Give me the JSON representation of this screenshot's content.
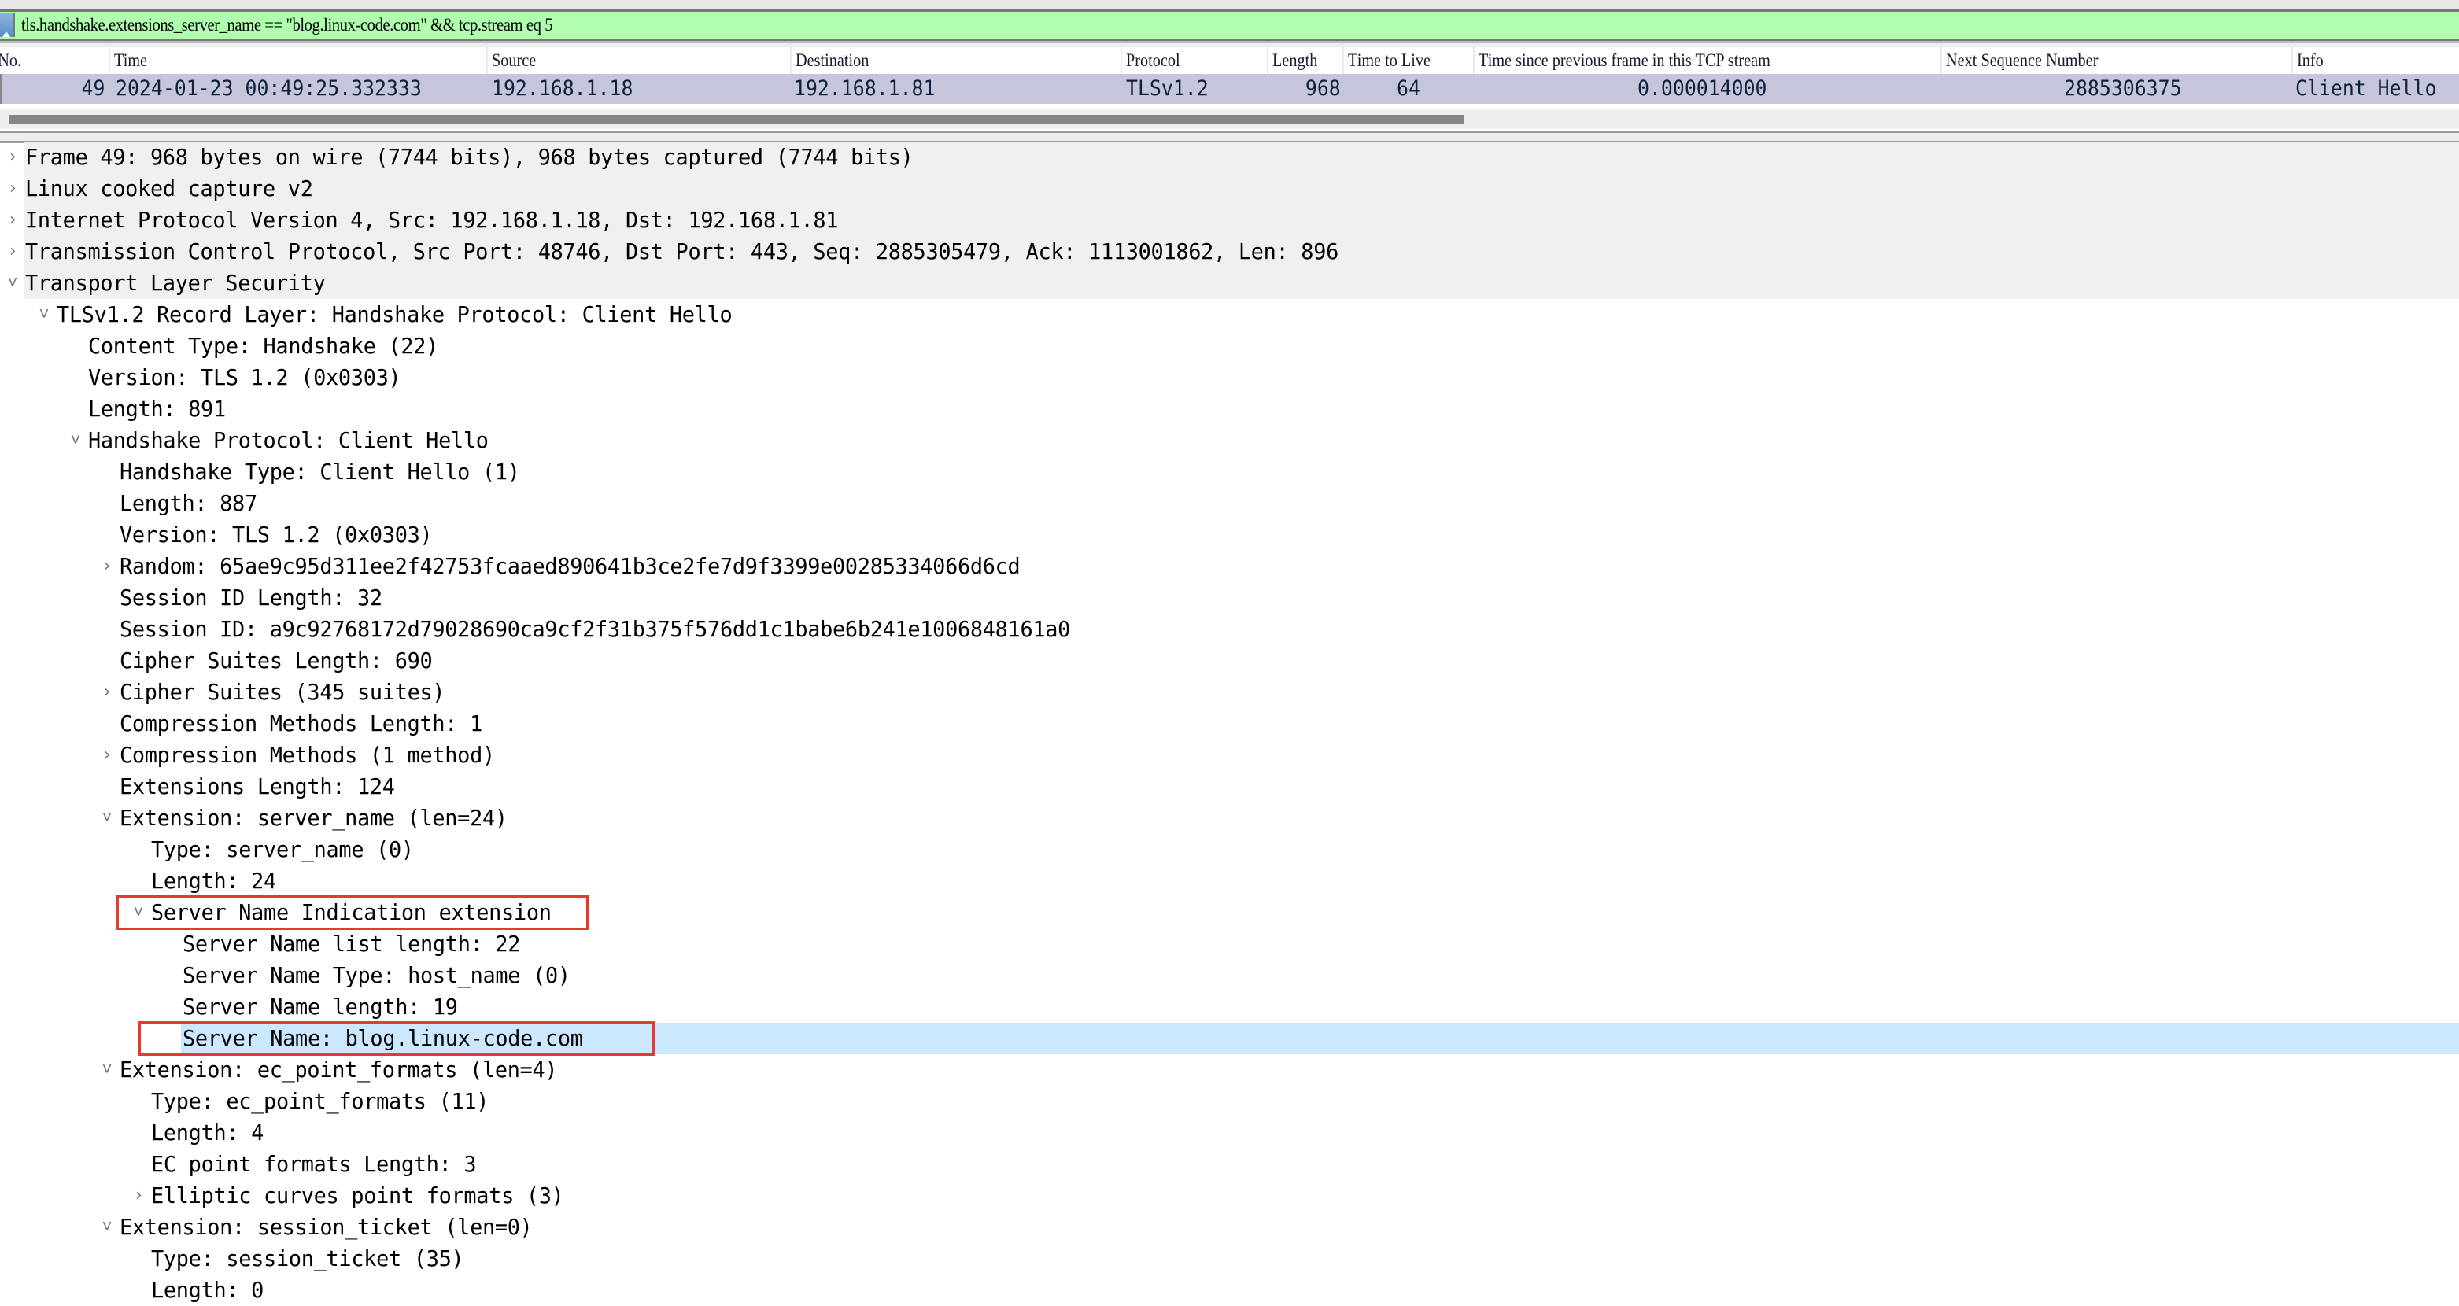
{
  "filter": {
    "expression": "tls.handshake.extensions_server_name == \"blog.linux-code.com\" && tcp.stream eq 5",
    "background": "#afffaf",
    "icon": "bookmark-filter-icon"
  },
  "packet_list": {
    "columns": [
      "No.",
      "Time",
      "Source",
      "Destination",
      "Protocol",
      "Length",
      "Time to Live",
      "Time since previous frame in this TCP stream",
      "Next Sequence Number",
      "Info"
    ],
    "rows": [
      {
        "no": "49",
        "time": "2024-01-23 00:49:25.332333",
        "source": "192.168.1.18",
        "destination": "192.168.1.81",
        "protocol": "TLSv1.2",
        "length": "968",
        "ttl": "64",
        "time_since_prev": "0.000014000",
        "next_seq": "2885306375",
        "info": "Client Hello",
        "selected": true
      }
    ],
    "selected_row_color": "#c5c5db"
  },
  "details": {
    "selected_color": "#cce8ff",
    "highlight_color": "#e53935",
    "rows": [
      {
        "depth": 0,
        "state": "collapsed",
        "text": "Frame 49: 968 bytes on wire (7744 bits), 968 bytes captured (7744 bits)"
      },
      {
        "depth": 0,
        "state": "collapsed",
        "text": "Linux cooked capture v2"
      },
      {
        "depth": 0,
        "state": "collapsed",
        "text": "Internet Protocol Version 4, Src: 192.168.1.18, Dst: 192.168.1.81"
      },
      {
        "depth": 0,
        "state": "collapsed",
        "text": "Transmission Control Protocol, Src Port: 48746, Dst Port: 443, Seq: 2885305479, Ack: 1113001862, Len: 896"
      },
      {
        "depth": 0,
        "state": "expanded",
        "text": "Transport Layer Security"
      },
      {
        "depth": 1,
        "state": "expanded",
        "text": "TLSv1.2 Record Layer: Handshake Protocol: Client Hello"
      },
      {
        "depth": 2,
        "state": "leaf",
        "text": "Content Type: Handshake (22)"
      },
      {
        "depth": 2,
        "state": "leaf",
        "text": "Version: TLS 1.2 (0x0303)"
      },
      {
        "depth": 2,
        "state": "leaf",
        "text": "Length: 891"
      },
      {
        "depth": 2,
        "state": "expanded",
        "text": "Handshake Protocol: Client Hello"
      },
      {
        "depth": 3,
        "state": "leaf",
        "text": "Handshake Type: Client Hello (1)"
      },
      {
        "depth": 3,
        "state": "leaf",
        "text": "Length: 887"
      },
      {
        "depth": 3,
        "state": "leaf",
        "text": "Version: TLS 1.2 (0x0303)"
      },
      {
        "depth": 3,
        "state": "collapsed",
        "text": "Random: 65ae9c95d311ee2f42753fcaaed890641b3ce2fe7d9f3399e00285334066d6cd"
      },
      {
        "depth": 3,
        "state": "leaf",
        "text": "Session ID Length: 32"
      },
      {
        "depth": 3,
        "state": "leaf",
        "text": "Session ID: a9c92768172d79028690ca9cf2f31b375f576dd1c1babe6b241e1006848161a0"
      },
      {
        "depth": 3,
        "state": "leaf",
        "text": "Cipher Suites Length: 690"
      },
      {
        "depth": 3,
        "state": "collapsed",
        "text": "Cipher Suites (345 suites)"
      },
      {
        "depth": 3,
        "state": "leaf",
        "text": "Compression Methods Length: 1"
      },
      {
        "depth": 3,
        "state": "collapsed",
        "text": "Compression Methods (1 method)"
      },
      {
        "depth": 3,
        "state": "leaf",
        "text": "Extensions Length: 124"
      },
      {
        "depth": 3,
        "state": "expanded",
        "text": "Extension: server_name (len=24)"
      },
      {
        "depth": 4,
        "state": "leaf",
        "text": "Type: server_name (0)"
      },
      {
        "depth": 4,
        "state": "leaf",
        "text": "Length: 24"
      },
      {
        "depth": 4,
        "state": "expanded",
        "text": "Server Name Indication extension",
        "boxed": true
      },
      {
        "depth": 5,
        "state": "leaf",
        "text": "Server Name list length: 22"
      },
      {
        "depth": 5,
        "state": "leaf",
        "text": "Server Name Type: host_name (0)"
      },
      {
        "depth": 5,
        "state": "leaf",
        "text": "Server Name length: 19"
      },
      {
        "depth": 5,
        "state": "leaf",
        "text": "Server Name: blog.linux-code.com",
        "boxed": true,
        "selected": true
      },
      {
        "depth": 3,
        "state": "expanded",
        "text": "Extension: ec_point_formats (len=4)"
      },
      {
        "depth": 4,
        "state": "leaf",
        "text": "Type: ec_point_formats (11)"
      },
      {
        "depth": 4,
        "state": "leaf",
        "text": "Length: 4"
      },
      {
        "depth": 4,
        "state": "leaf",
        "text": "EC point formats Length: 3"
      },
      {
        "depth": 4,
        "state": "collapsed",
        "text": "Elliptic curves point formats (3)"
      },
      {
        "depth": 3,
        "state": "expanded",
        "text": "Extension: session_ticket (len=0)"
      },
      {
        "depth": 4,
        "state": "leaf",
        "text": "Type: session_ticket (35)"
      },
      {
        "depth": 4,
        "state": "leaf",
        "text": "Length: 0"
      }
    ]
  }
}
